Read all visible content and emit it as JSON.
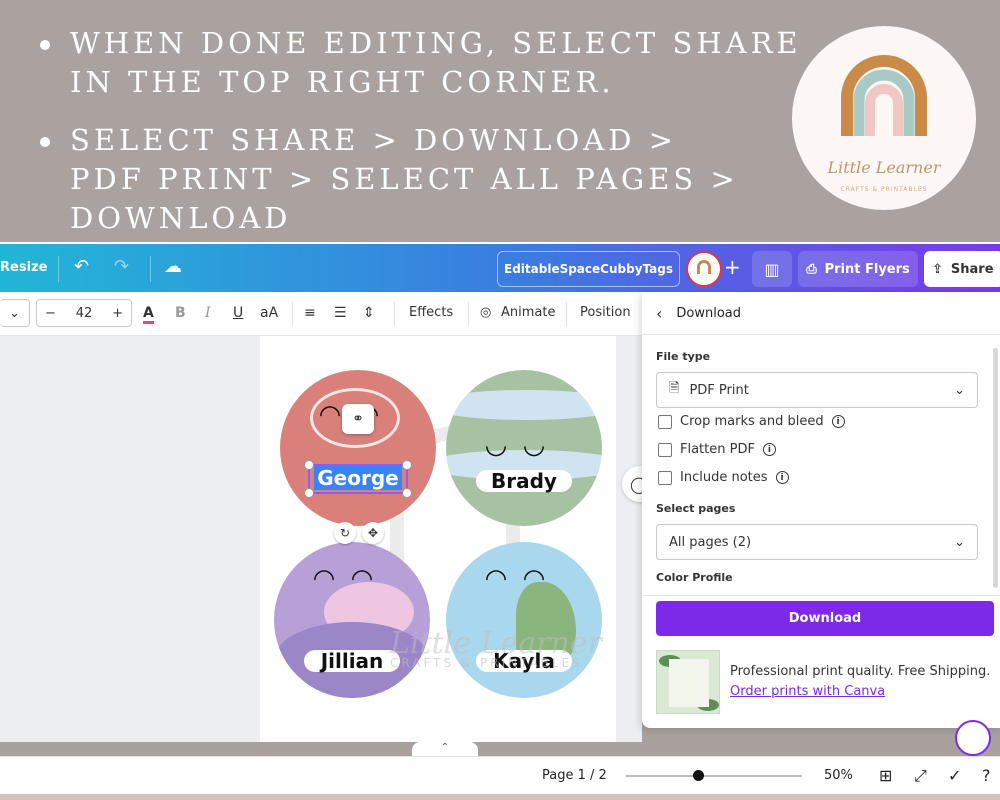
{
  "instructions": [
    "WHEN DONE EDITING, SELECT SHARE IN THE TOP RIGHT CORNER.",
    "SELECT SHARE > DOWNLOAD > PDF PRINT > SELECT ALL PAGES > DOWNLOAD"
  ],
  "logo": {
    "name": "Little Learner",
    "tagline": "CRAFTS & PRINTABLES"
  },
  "topbar": {
    "resize_label": "Resize",
    "file_name": "EditableSpaceCubbyTags",
    "print_label": "Print Flyers",
    "share_label": "Share"
  },
  "toolbar": {
    "font_size": "42",
    "minus": "−",
    "plus": "+",
    "effects_label": "Effects",
    "animate_label": "Animate",
    "position_label": "Position",
    "case_label": "aA"
  },
  "tags": [
    {
      "name": "George",
      "color": "#d9807a"
    },
    {
      "name": "Brady",
      "color": "#a6c2a2"
    },
    {
      "name": "Jillian",
      "color": "#b7a0d8"
    },
    {
      "name": "Kayla",
      "color": "#a9d8ee"
    }
  ],
  "download_panel": {
    "title": "Download",
    "file_type_label": "File type",
    "file_type_value": "PDF Print",
    "options": [
      {
        "label": "Crop marks and bleed",
        "checked": false
      },
      {
        "label": "Flatten PDF",
        "checked": false
      },
      {
        "label": "Include notes",
        "checked": false
      }
    ],
    "select_pages_label": "Select pages",
    "select_pages_value": "All pages (2)",
    "color_profile_label": "Color Profile",
    "download_button": "Download",
    "promo_text": "Professional print quality. Free Shipping.",
    "promo_link": "Order prints with Canva"
  },
  "statusbar": {
    "page_indicator": "Page 1 / 2",
    "zoom": "50%"
  },
  "colors": {
    "accent": "#7d2ae8",
    "banner_bg": "#aaa29f",
    "selection_blue": "#3b82f6"
  }
}
